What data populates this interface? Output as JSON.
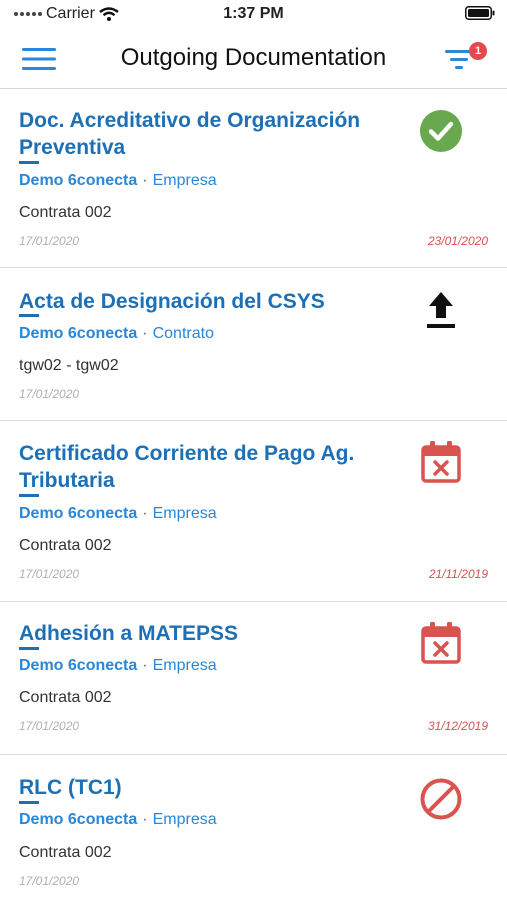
{
  "status_bar": {
    "carrier": "Carrier",
    "time": "1:37 PM"
  },
  "header": {
    "title": "Outgoing Documentation",
    "filter_badge": "1"
  },
  "colors": {
    "accent": "#1d6fb6",
    "link": "#2a86d6",
    "danger": "#d9534f",
    "success": "#6aa84f"
  },
  "items": [
    {
      "title": "Doc. Acreditativo de Organización Preventiva",
      "company": "Demo 6conecta",
      "sep": "·",
      "type": "Empresa",
      "detail": "Contrata 002",
      "date_created": "17/01/2020",
      "date_due": "23/01/2020",
      "status_icon": "check-circle-icon"
    },
    {
      "title": "Acta de Designación del CSYS",
      "company": "Demo 6conecta",
      "sep": "·",
      "type": "Contrato",
      "detail": "tgw02 - tgw02",
      "date_created": "17/01/2020",
      "date_due": "",
      "status_icon": "upload-icon"
    },
    {
      "title": "Certificado Corriente de Pago Ag. Tributaria",
      "company": "Demo 6conecta",
      "sep": "·",
      "type": "Empresa",
      "detail": "Contrata 002",
      "date_created": "17/01/2020",
      "date_due": "21/11/2019",
      "status_icon": "calendar-expired-icon"
    },
    {
      "title": "Adhesión a MATEPSS",
      "company": "Demo 6conecta",
      "sep": "·",
      "type": "Empresa",
      "detail": "Contrata 002",
      "date_created": "17/01/2020",
      "date_due": "31/12/2019",
      "status_icon": "calendar-expired-icon"
    },
    {
      "title": "RLC (TC1)",
      "company": "Demo 6conecta",
      "sep": "·",
      "type": "Empresa",
      "detail": "Contrata 002",
      "date_created": "17/01/2020",
      "date_due": "",
      "status_icon": "blocked-icon"
    }
  ]
}
